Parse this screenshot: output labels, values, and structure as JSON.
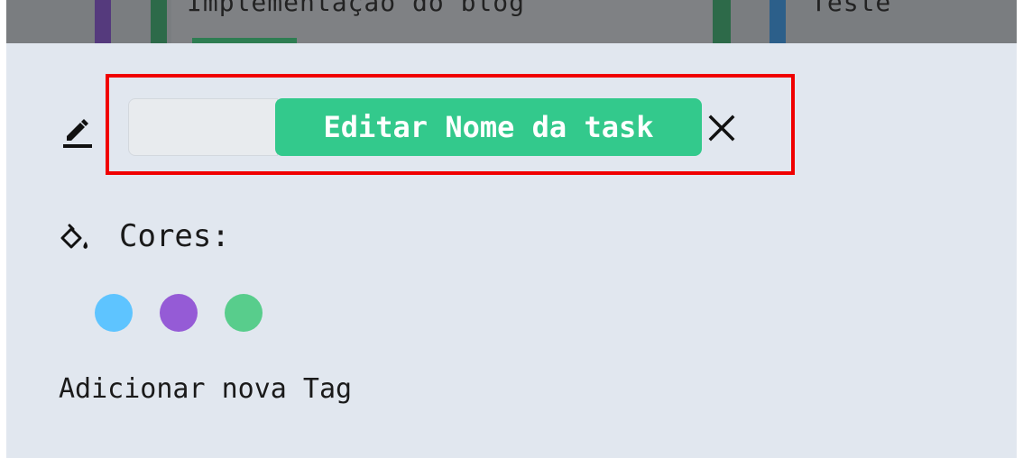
{
  "background_board": {
    "card_left_title": "Implementação do blog",
    "card_right_title": "Teste"
  },
  "edit_name": {
    "input_value": "",
    "button_label": "Editar Nome da task"
  },
  "colors_section": {
    "label": "Cores:",
    "swatches": [
      {
        "name": "light-blue",
        "color": "#5ec4ff"
      },
      {
        "name": "purple",
        "color": "#955bd6"
      },
      {
        "name": "green",
        "color": "#58cd8c"
      }
    ]
  },
  "tags": {
    "add_label": "Adicionar nova Tag"
  },
  "theme": {
    "modal_bg": "#e1e7ef",
    "button_green": "#33c98c",
    "highlight_red": "#f00000"
  },
  "icons": {
    "edit": "pencil-icon",
    "close": "close-icon",
    "paint": "paint-bucket-icon"
  }
}
